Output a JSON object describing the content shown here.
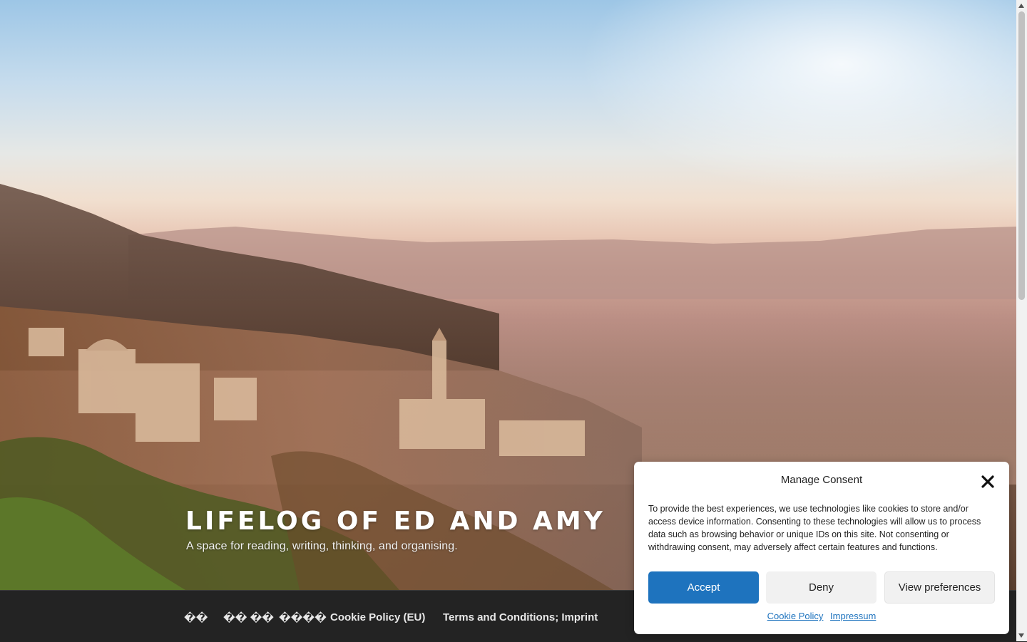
{
  "site": {
    "title": "LIFELOG OF ED AND AMY",
    "tagline": "A space for reading, writing, thinking, and organising."
  },
  "nav": {
    "items": [
      {
        "label": "��"
      },
      {
        "label": "�� ��"
      },
      {
        "label": "����"
      },
      {
        "label": "Cookie Policy (EU)"
      },
      {
        "label": "Terms and Conditions; Imprint"
      }
    ]
  },
  "consent": {
    "title": "Manage Consent",
    "text": "To provide the best experiences, we use technologies like cookies to store and/or access device information. Consenting to these technologies will allow us to process data such as browsing behavior or unique IDs on this site. Not consenting or withdrawing consent, may adversely affect certain features and functions.",
    "accept_label": "Accept",
    "deny_label": "Deny",
    "preferences_label": "View preferences",
    "links": [
      {
        "label": "Cookie Policy"
      },
      {
        "label": "Impressum"
      }
    ]
  },
  "colors": {
    "accent": "#1e73be",
    "navbar": "#232323"
  },
  "icons": {
    "close": "close-icon"
  }
}
